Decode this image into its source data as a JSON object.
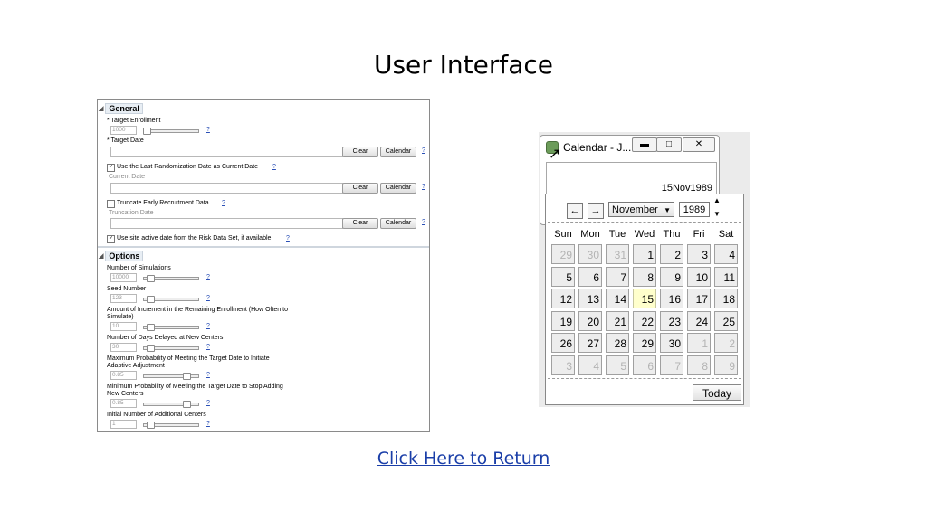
{
  "page": {
    "title": "User Interface",
    "return_link": "Click Here to Return"
  },
  "general": {
    "header": "General",
    "target_enrollment": {
      "label": "* Target Enrollment",
      "value": "1000",
      "level": 0.08
    },
    "target_date": {
      "label": "* Target Date"
    },
    "clear_label": "Clear",
    "calendar_label": "Calendar",
    "help": "?",
    "use_last_randomization": {
      "label": "Use the Last Randomization Date as Current Date",
      "checked": true
    },
    "current_date": {
      "label": "Current Date"
    },
    "truncate_early": {
      "label": "Truncate Early Recruitment Data",
      "checked": false
    },
    "truncation_date": {
      "label": "Truncation Date"
    },
    "use_site_active": {
      "label": "Use site active date from the Risk Data Set, if available",
      "checked": true
    }
  },
  "options": {
    "header": "Options",
    "items": [
      {
        "label": "Number of Simulations",
        "value": "10000",
        "level": 0.08
      },
      {
        "label": "Seed Number",
        "value": "123",
        "level": 0.08
      },
      {
        "label": "Amount of Increment in the Remaining Enrollment  (How Often to",
        "label2": "Simulate)",
        "value": "10",
        "level": 0.08
      },
      {
        "label": "Number of Days Delayed at New Centers",
        "value": "30",
        "level": 0.08
      },
      {
        "label": "Maximum Probability of Meeting the Target Date to Initiate",
        "label2": "Adaptive Adjustment",
        "value": "0.85",
        "level": 0.85
      },
      {
        "label": "Minimum Probability of Meeting the Target Date to Stop Adding",
        "label2": "New Centers",
        "value": "0.85",
        "level": 0.85
      },
      {
        "label": "Initial Number of Additional Centers",
        "value": "1",
        "level": 0.08
      }
    ]
  },
  "calendar": {
    "window_title": "Calendar - J...",
    "date_value": "15Nov1989",
    "month": "November",
    "year": "1989",
    "weekdays": [
      "Sun",
      "Mon",
      "Tue",
      "Wed",
      "Thu",
      "Fri",
      "Sat"
    ],
    "weeks": [
      [
        "29",
        "30",
        "31",
        "1",
        "2",
        "3",
        "4"
      ],
      [
        "5",
        "6",
        "7",
        "8",
        "9",
        "10",
        "11"
      ],
      [
        "12",
        "13",
        "14",
        "15",
        "16",
        "17",
        "18"
      ],
      [
        "19",
        "20",
        "21",
        "22",
        "23",
        "24",
        "25"
      ],
      [
        "26",
        "27",
        "28",
        "29",
        "30",
        "1",
        "2"
      ],
      [
        "3",
        "4",
        "5",
        "6",
        "7",
        "8",
        "9"
      ]
    ],
    "selected_day": "15",
    "today_label": "Today",
    "icons": {
      "prev": "arrow-left-icon",
      "next": "arrow-right-icon",
      "minimize": "minimize-icon",
      "maximize": "maximize-icon",
      "close": "close-icon"
    }
  }
}
